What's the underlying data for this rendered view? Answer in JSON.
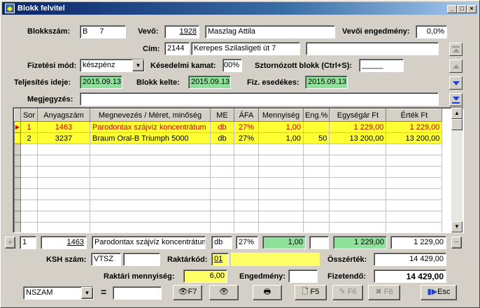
{
  "window": {
    "title": "Blokk felvitel",
    "controls": [
      "_",
      "□",
      "×"
    ]
  },
  "header": {
    "blokkszam_label": "Blokkszám:",
    "blokkszam_prefix": "B",
    "blokkszam_value": "7",
    "vevo_label": "Vevő:",
    "vevo_code": "1928",
    "vevo_name": "Maszlag Attila",
    "engedmeny_label": "Vevői engedmény:",
    "engedmeny_value": "0,0%",
    "cim_label": "Cím:",
    "cim_zip": "2144",
    "cim_street": "Kerepes Szilasligeti út 7",
    "cim_extra": "",
    "fizmod_label": "Fizetési mód:",
    "fizmod_value": "készpénz",
    "kamat_label": "Késedelmi kamat:",
    "kamat_value": "00%",
    "sztorno_label": "Sztornózott blokk (Ctrl+S):",
    "sztorno_value": "_____",
    "teljesites_label": "Teljesítés ideje:",
    "teljesites_value": "2015.09.13",
    "kelte_label": "Blokk kelte:",
    "kelte_value": "2015.09.13",
    "esedekes_label": "Fiz. esedékes:",
    "esedekes_value": "2015.09.13",
    "megjegyzes_label": "Megjegyzés:",
    "megjegyzes_value": ""
  },
  "grid": {
    "columns": [
      "Sor",
      "Anyagszám",
      "Megnevezés / Méret, minőség",
      "ME",
      "ÁFA",
      "Mennyiség",
      "Eng.%",
      "Egységár Ft",
      "Érték Ft"
    ],
    "rows": [
      {
        "sor": "1",
        "anyagszam": "1463",
        "megnevezes": "Parodontax szájvíz koncentrátum",
        "me": "db",
        "afa": "27%",
        "mennyiseg": "1,00",
        "eng": "",
        "egysegar": "1 229,00",
        "ertek": "1 229,00"
      },
      {
        "sor": "2",
        "anyagszam": "3237",
        "megnevezes": "Braum Oral-B Triumph 5000",
        "me": "db",
        "afa": "27%",
        "mennyiseg": "1,00",
        "eng": "50",
        "egysegar": "13 200,00",
        "ertek": "13 200,00"
      }
    ],
    "empty_rows": 9
  },
  "editrow": {
    "plus": "+",
    "minus": "−",
    "sor": "1",
    "anyagszam": "1463",
    "megnevezes": "Parodontax szájvíz koncentrátum",
    "me": "db",
    "afa": "27%",
    "mennyiseg": "1,00",
    "eng": "",
    "egysegar": "1 229,00",
    "ertek": "1 229,00"
  },
  "footer": {
    "ksh_label": "KSH szám:",
    "ksh_value": "VTSZ",
    "ksh_extra": "",
    "raktarkod_label": "Raktárkód:",
    "raktarkod_value": "01",
    "raktarkod_name": "",
    "osszertek_label": "Összérték:",
    "osszertek_value": "14 429,00",
    "raktari_label": "Raktári mennyiség:",
    "raktari_value": "6,00",
    "engedmeny_label": "Engedmény:",
    "engedmeny_value": "",
    "fizetendo_label": "Fizetendő:",
    "fizetendo_value": "14 429,00"
  },
  "toolbar": {
    "search_field": "NSZAM",
    "equals": "=",
    "search_value": "",
    "f7": "F7",
    "f5": "F5",
    "f6": "F6",
    "f8": "F8",
    "esc": "Esc"
  }
}
